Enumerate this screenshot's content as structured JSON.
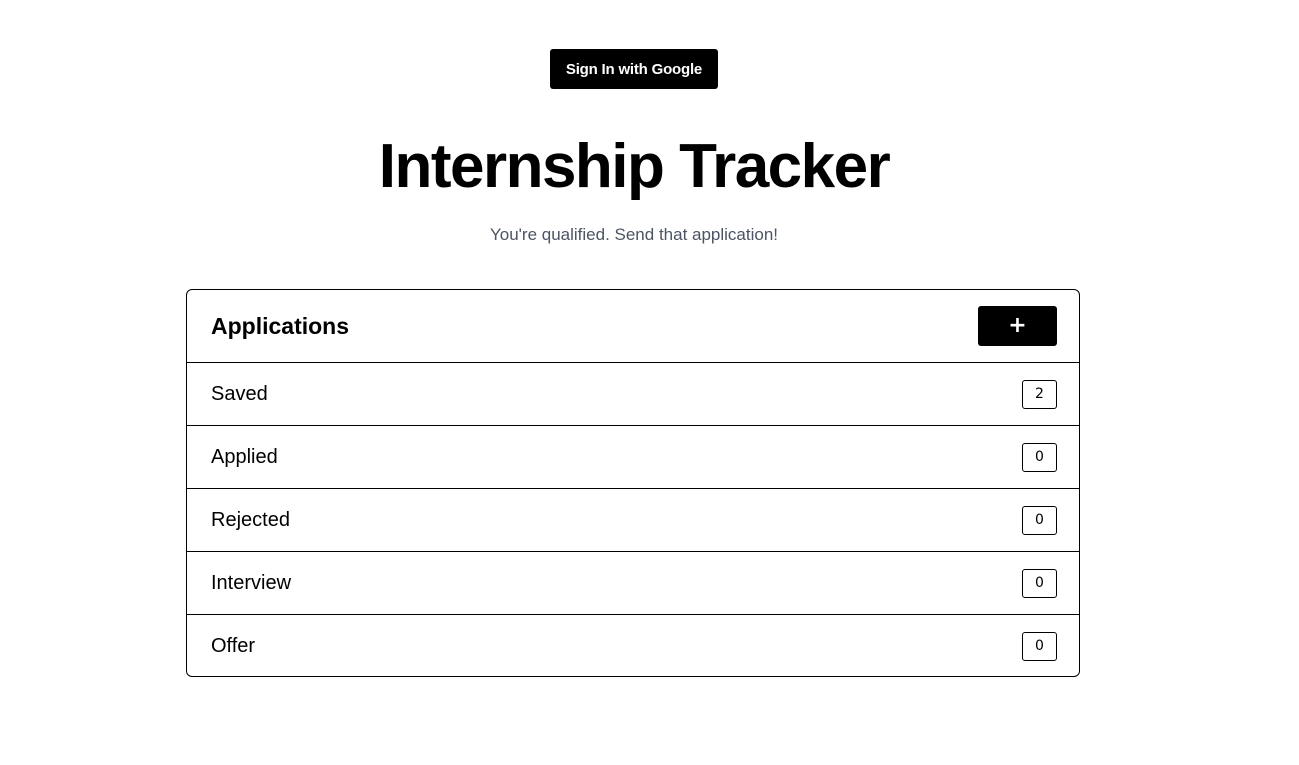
{
  "header": {
    "signin_label": "Sign In with Google"
  },
  "hero": {
    "title": "Internship Tracker",
    "subtitle": "You're qualified. Send that application!"
  },
  "applications": {
    "title": "Applications",
    "add_label": "+",
    "statuses": [
      {
        "label": "Saved",
        "count": "2"
      },
      {
        "label": "Applied",
        "count": "0"
      },
      {
        "label": "Rejected",
        "count": "0"
      },
      {
        "label": "Interview",
        "count": "0"
      },
      {
        "label": "Offer",
        "count": "0"
      }
    ]
  }
}
